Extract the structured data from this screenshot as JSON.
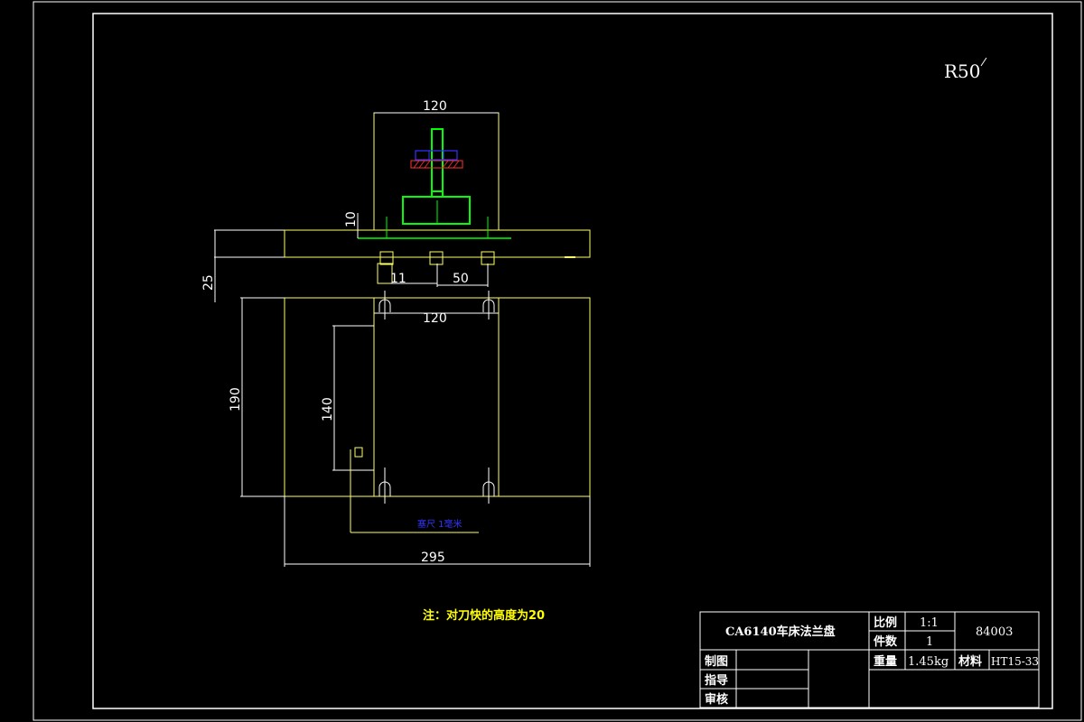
{
  "roughness": {
    "label": "R50",
    "color": "#ffffff"
  },
  "dims": {
    "top_width": "120",
    "plate_thickness": "10",
    "overall_height_left": "25",
    "gap_a": "11",
    "gap_b": "50",
    "inner_width": "120",
    "overall_height": "190",
    "inner_height": "140",
    "overall_width": "295"
  },
  "annotation_blue": "塞尺 1毫米",
  "note": "注：对刀快的高度为20",
  "title_block": {
    "part_name": "CA6140车床法兰盘",
    "scale_label": "比例",
    "scale_value": "1:1",
    "quantity_label": "件数",
    "quantity_value": "1",
    "drawing_no": "84003",
    "weight_label": "重量",
    "weight_value": "1.45kg",
    "material_label": "材料",
    "material_value": "HT15-33",
    "drawn_label": "制图",
    "guide_label": "指导",
    "review_label": "审核"
  },
  "colors": {
    "background": "#000000",
    "frame": "#ffffff",
    "outline": "#ffff66",
    "green": "#00ff00",
    "blue": "#3333ff",
    "red": "#ff3333",
    "note": "#ffff00"
  }
}
